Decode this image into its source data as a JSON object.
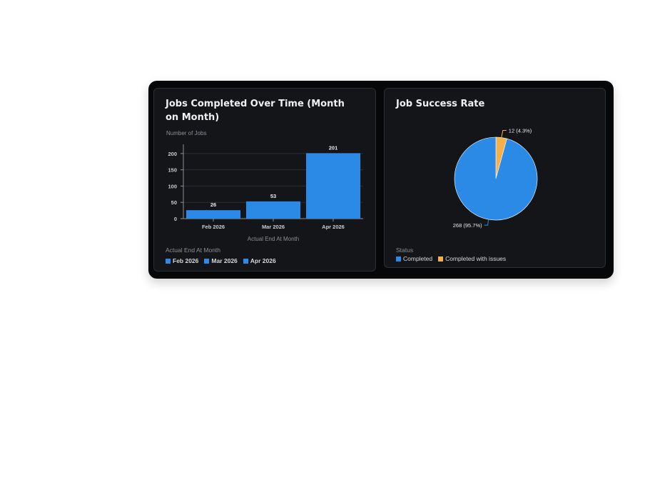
{
  "colors": {
    "bar": "#2b8ae6",
    "completed": "#2b8ae6",
    "issues": "#f6b04b",
    "axis_text": "#c9ccd1",
    "muted_text": "#8b9096",
    "grid": "#2a2d31"
  },
  "left_card": {
    "title": "Jobs Completed Over Time (Month on Month)",
    "legend_title": "Actual End At Month",
    "legend": [
      "Feb 2026",
      "Mar 2026",
      "Apr 2026"
    ]
  },
  "right_card": {
    "title": "Job Success Rate",
    "legend_title": "Status",
    "legend": [
      "Completed",
      "Completed with issues"
    ]
  },
  "chart_data": [
    {
      "type": "bar",
      "title": "Jobs Completed Over Time (Month on Month)",
      "categories": [
        "Feb 2026",
        "Mar 2026",
        "Apr 2026"
      ],
      "values": [
        26,
        53,
        201
      ],
      "data_labels": [
        "26",
        "53",
        "201"
      ],
      "xlabel": "Actual End At Month",
      "ylabel": "Number of Jobs",
      "ylim": [
        0,
        215
      ],
      "yticks": [
        0,
        50,
        100,
        150,
        200
      ],
      "grid": true,
      "legend_placement": "bottom"
    },
    {
      "type": "pie",
      "title": "Job Success Rate",
      "labels": [
        "Completed",
        "Completed with issues"
      ],
      "values": [
        268,
        12
      ],
      "data_labels": [
        "268 (95.7%)",
        "12 (4.3%)"
      ],
      "legend_placement": "bottom"
    }
  ]
}
